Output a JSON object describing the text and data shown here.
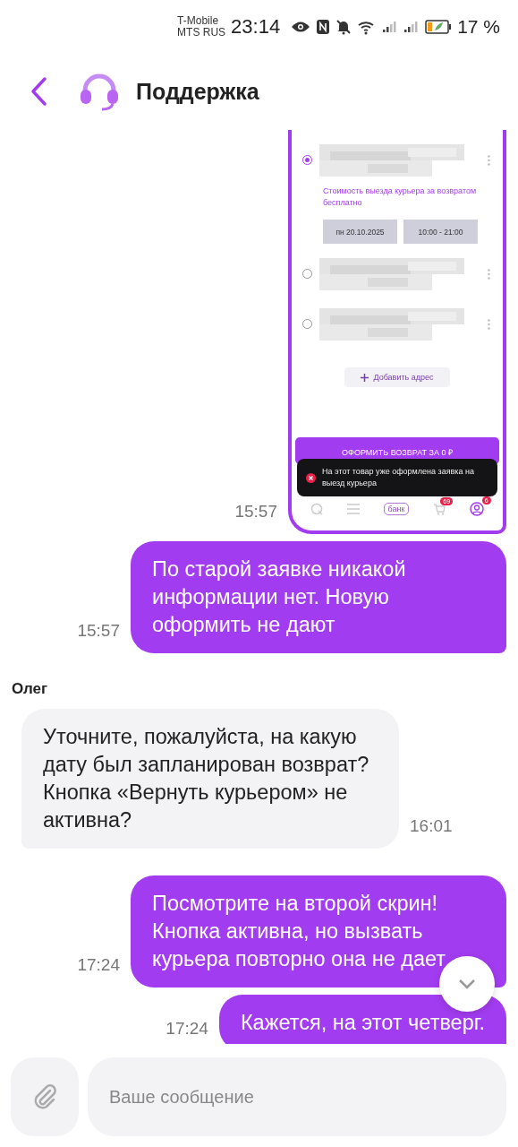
{
  "status_bar": {
    "carriers": [
      "T-Mobile",
      "MTS RUS"
    ],
    "time": "23:14",
    "battery": "17 %"
  },
  "header": {
    "title": "Поддержка"
  },
  "messages": [
    {
      "kind": "screenshot",
      "outgoing": true,
      "time": "15:57",
      "screen": {
        "addresses": [
          {
            "selected": true,
            "note": "Стоимость выезда курьера за возвратом бесплатно",
            "date": "пн 20.10.2025",
            "slot": "10:00 - 21:00"
          },
          {
            "selected": false
          },
          {
            "selected": false
          }
        ],
        "add_address": "Добавить адрес",
        "submit": "ОФОРМИТЬ ВОЗВРАТ ЗА 0 ₽",
        "toast": "На этот товар уже оформлена заявка на выезд курьера",
        "nav": {
          "bank": "банк",
          "cart_badge": "69",
          "profile_badge": "6"
        }
      }
    },
    {
      "kind": "text",
      "outgoing": true,
      "time": "15:57",
      "text": "По старой заявке никакой информации нет. Новую оформить не дают"
    },
    {
      "kind": "text",
      "outgoing": false,
      "sender": "Олег",
      "time": "16:01",
      "text": "Уточните, пожалуйста, на какую дату был запланирован возврат? Кнопка «Вернуть курьером» не активна?"
    },
    {
      "kind": "text",
      "outgoing": true,
      "time": "17:24",
      "text": "Посмотрите на второй скрин! Кнопка активна, но вызвать курьера повторно она не дает"
    },
    {
      "kind": "text",
      "outgoing": true,
      "time": "17:24",
      "text": "Кажется, на этот четверг."
    }
  ],
  "composer": {
    "placeholder": "Ваше сообщение"
  }
}
